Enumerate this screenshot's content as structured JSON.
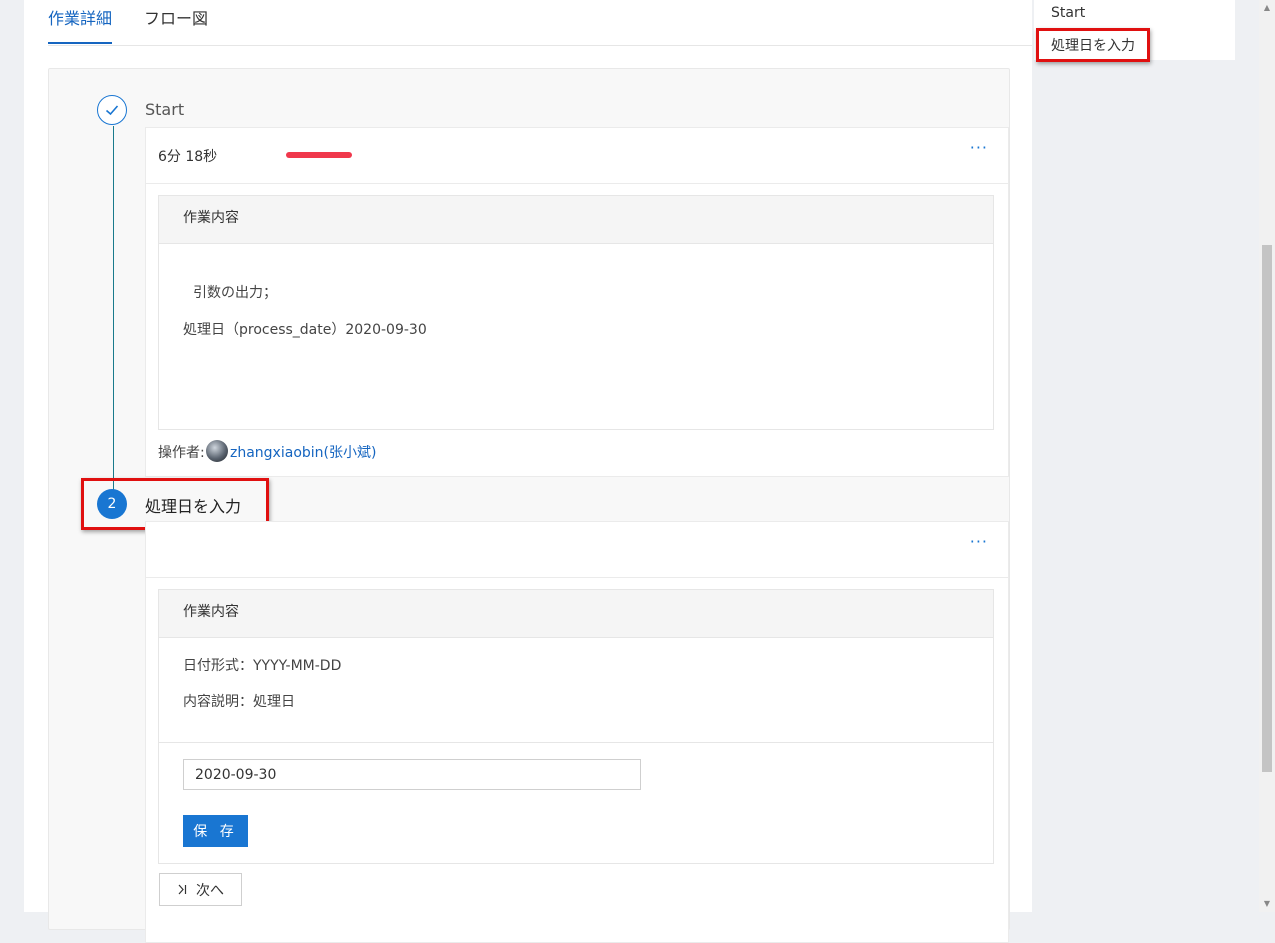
{
  "tabs": [
    {
      "label": "作業詳細",
      "active": true
    },
    {
      "label": "フロー図",
      "active": false
    }
  ],
  "steps": [
    {
      "status": "done",
      "title": "Start",
      "duration": "6分 18秒",
      "menu": "···",
      "content": {
        "header": "作業内容",
        "lines": [
          "引数の出力；",
          "処理日（process_date）2020-09-30"
        ]
      },
      "operator": {
        "label": "操作者:",
        "name": "zhangxiaobin(张小斌)"
      }
    },
    {
      "status": "current",
      "number": "2",
      "title": "処理日を入力",
      "menu": "···",
      "content": {
        "header": "作業内容",
        "lines": [
          "日付形式：YYYY-MM-DD",
          "内容説明：処理日"
        ]
      },
      "input_value": "2020-09-30",
      "save_label": "保 存",
      "next_label": "次へ"
    }
  ],
  "right_panel": {
    "items": [
      "Start",
      "処理日を入力"
    ]
  },
  "colors": {
    "accent": "#1976d2",
    "highlight_box": "#e01010",
    "redacted": "#f0384c",
    "timeline": "#1a7a8c"
  }
}
